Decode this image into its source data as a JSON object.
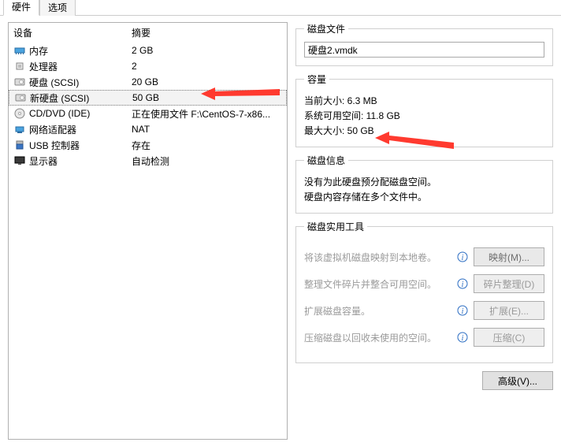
{
  "tabs": {
    "hardware": "硬件",
    "options": "选项"
  },
  "left": {
    "header_device": "设备",
    "header_summary": "摘要",
    "rows": [
      {
        "name": "内存",
        "summary": "2 GB"
      },
      {
        "name": "处理器",
        "summary": "2"
      },
      {
        "name": "硬盘 (SCSI)",
        "summary": "20 GB"
      },
      {
        "name": "新硬盘 (SCSI)",
        "summary": "50 GB"
      },
      {
        "name": "CD/DVD (IDE)",
        "summary": "正在使用文件 F:\\CentOS-7-x86..."
      },
      {
        "name": "网络适配器",
        "summary": "NAT"
      },
      {
        "name": "USB 控制器",
        "summary": "存在"
      },
      {
        "name": "显示器",
        "summary": "自动检测"
      }
    ]
  },
  "right": {
    "diskfile_legend": "磁盘文件",
    "diskfile_value": "硬盘2.vmdk",
    "capacity_legend": "容量",
    "cap_current": "当前大小: 6.3 MB",
    "cap_sysfree": "系统可用空间: 11.8 GB",
    "cap_max": "最大大小: 50 GB",
    "diskinfo_legend": "磁盘信息",
    "diskinfo_line1": "没有为此硬盘预分配磁盘空间。",
    "diskinfo_line2": "硬盘内容存储在多个文件中。",
    "util_legend": "磁盘实用工具",
    "util_map_label": "将该虚拟机磁盘映射到本地卷。",
    "util_map_btn": "映射(M)...",
    "util_defrag_label": "整理文件碎片并整合可用空间。",
    "util_defrag_btn": "碎片整理(D)",
    "util_expand_label": "扩展磁盘容量。",
    "util_expand_btn": "扩展(E)...",
    "util_compact_label": "压缩磁盘以回收未使用的空间。",
    "util_compact_btn": "压缩(C)",
    "advanced_btn": "高级(V)..."
  }
}
